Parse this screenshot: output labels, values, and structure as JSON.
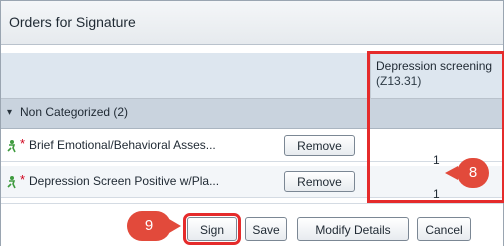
{
  "window": {
    "title": "Orders for Signature"
  },
  "grid": {
    "column_header": {
      "line1": "Depression screening",
      "line2": "(Z13.31)"
    },
    "group": {
      "toggle_glyph": "▾",
      "label": "Non Categorized (2)"
    },
    "rows": [
      {
        "icon": "order-person-icon",
        "required_marker": "*",
        "name": "Brief Emotional/Behavioral Asses...",
        "remove_label": "Remove",
        "quantity": "1"
      },
      {
        "icon": "order-person-icon",
        "required_marker": "*",
        "name": "Depression Screen Positive w/Pla...",
        "remove_label": "Remove",
        "quantity": "1"
      }
    ]
  },
  "callouts": {
    "diagnosis_step": "8",
    "sign_step": "9"
  },
  "footer": {
    "sign": "Sign",
    "save": "Save",
    "modify_details": "Modify Details",
    "cancel": "Cancel"
  },
  "colors": {
    "annotation_red": "#e52b2b",
    "callout_fill": "#e24a3b",
    "header_bg": "#dde6ef",
    "group_bg": "#c9d3de",
    "order_icon_green": "#3f9b3f"
  }
}
